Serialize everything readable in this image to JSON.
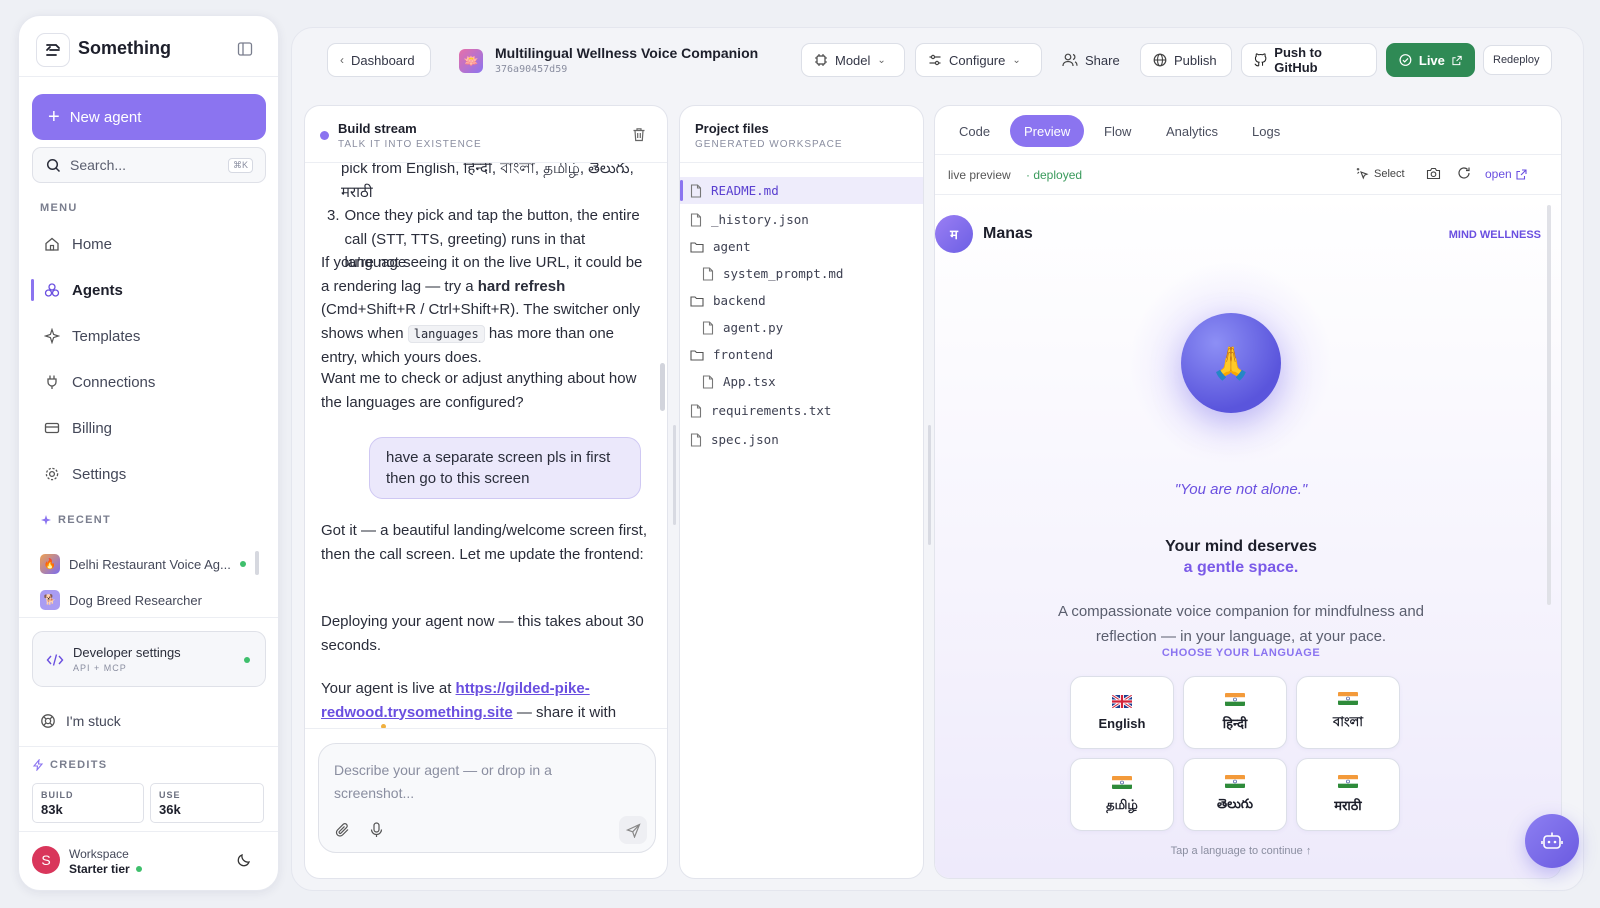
{
  "sidebar": {
    "brand": "Something",
    "new_agent": "New agent",
    "search_placeholder": "Search...",
    "search_shortcut": "⌘K",
    "menu_label": "MENU",
    "menu": [
      {
        "label": "Home"
      },
      {
        "label": "Agents"
      },
      {
        "label": "Templates"
      },
      {
        "label": "Connections"
      },
      {
        "label": "Billing"
      },
      {
        "label": "Settings"
      }
    ],
    "recent_label": "RECENT",
    "recent": [
      {
        "label": "Delhi Restaurant Voice Ag..."
      },
      {
        "label": "Dog Breed Researcher"
      }
    ],
    "dev_settings": {
      "title": "Developer settings",
      "sub": "API + MCP"
    },
    "stuck": "I'm stuck",
    "credits_label": "CREDITS",
    "credits": [
      {
        "label": "BUILD",
        "value": "83k"
      },
      {
        "label": "USE",
        "value": "36k"
      }
    ],
    "workspace": {
      "avatar": "S",
      "name": "Workspace",
      "tier": "Starter tier"
    }
  },
  "topbar": {
    "back": "Dashboard",
    "agent_name": "Multilingual Wellness Voice Companion",
    "agent_id": "376a90457d59",
    "model": "Model",
    "configure": "Configure",
    "share": "Share",
    "publish": "Publish",
    "github": "Push to GitHub",
    "live": "Live",
    "redeploy": "Redeploy"
  },
  "build": {
    "title": "Build stream",
    "sub": "TALK IT INTO EXISTENCE",
    "msg1_line_a": "pick from English, हिन्दी, বাংলা, தமிழ், తెలుగు,",
    "msg1_line_b": "मराठी",
    "step3_num": "3.",
    "step3": "Once they pick and tap the button, the entire call (STT, TTS, greeting) runs in that language",
    "p1_a": "If you're not seeing it on the live URL, it could be a rendering lag — try a ",
    "p1_bold": "hard refresh",
    "p1_b": " (Cmd+Shift+R / Ctrl+Shift+R). The switcher only shows when ",
    "p1_code": "languages",
    "p1_c": " has more than one entry, which yours does.",
    "p2": "Want me to check or adjust anything about how the languages are configured?",
    "user_msg": "have a separate screen pls in first then go to this screen",
    "reply1": "Got it — a beautiful landing/welcome screen first, then the call screen. Let me update the frontend:",
    "reply2": "Deploying your agent now — this takes about 30 seconds.",
    "reply3_a": "Your agent is live at ",
    "reply3_link": "https://gilded-pike-redwood.trysomething.site",
    "reply3_b": " — share it with",
    "input_placeholder": "Describe your agent — or drop in a screenshot..."
  },
  "files": {
    "title": "Project files",
    "sub": "GENERATED WORKSPACE",
    "items": [
      {
        "name": "README.md"
      },
      {
        "name": "_history.json"
      },
      {
        "name": "agent"
      },
      {
        "name": "system_prompt.md"
      },
      {
        "name": "backend"
      },
      {
        "name": "agent.py"
      },
      {
        "name": "frontend"
      },
      {
        "name": "App.tsx"
      },
      {
        "name": "requirements.txt"
      },
      {
        "name": "spec.json"
      }
    ]
  },
  "preview": {
    "tabs": [
      "Code",
      "Preview",
      "Flow",
      "Analytics",
      "Logs"
    ],
    "live_preview": "live preview",
    "deployed": "· deployed",
    "select": "Select",
    "open": "open",
    "app": {
      "avatar": "म",
      "name": "Manas",
      "tag": "MIND WELLNESS",
      "orb_emoji": "🙏",
      "quote": "\"You are not alone.\"",
      "headline_a": "Your mind deserves",
      "headline_b": "a gentle space.",
      "desc": "A compassionate voice companion for mindfulness and reflection — in your language, at your pace.",
      "choose": "CHOOSE YOUR LANGUAGE",
      "languages": [
        {
          "name": "English",
          "flag": "uk"
        },
        {
          "name": "हिन्दी",
          "flag": "in"
        },
        {
          "name": "বাংলা",
          "flag": "in"
        },
        {
          "name": "தமிழ்",
          "flag": "in"
        },
        {
          "name": "తెలుగు",
          "flag": "in"
        },
        {
          "name": "मराठी",
          "flag": "in"
        }
      ],
      "hint": "Tap a language to continue ↑"
    }
  },
  "colors": {
    "accent": "#8b74f0",
    "live": "#2f8a55",
    "deployed": "#3a9a5c"
  }
}
